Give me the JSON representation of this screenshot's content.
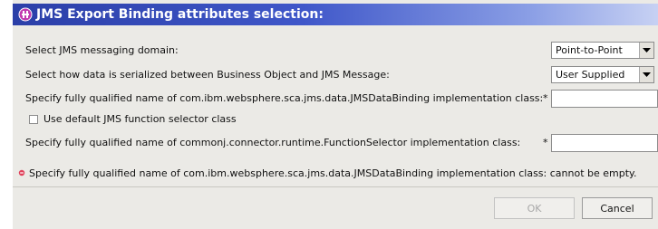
{
  "dialog": {
    "title": "JMS Export Binding attributes selection:",
    "title_icon": "plugin-icon",
    "messaging_domain": {
      "label": "Select JMS messaging domain:",
      "value": "Point-to-Point"
    },
    "serialization": {
      "label": "Select how data is serialized between Business Object and JMS Message:",
      "value": "User Supplied"
    },
    "databinding_class": {
      "label": "Specify fully qualified name of com.ibm.websphere.sca.jms.data.JMSDataBinding implementation class:",
      "required_mark": "*",
      "value": ""
    },
    "default_selector": {
      "label": "Use default JMS function selector class",
      "checked": false
    },
    "selector_class": {
      "label": "Specify fully qualified name of commonj.connector.runtime.FunctionSelector implementation class:",
      "required_mark": "*",
      "value": ""
    },
    "error_message": "Specify fully qualified name of com.ibm.websphere.sca.jms.data.JMSDataBinding implementation class: cannot be empty.",
    "buttons": {
      "ok": "OK",
      "cancel": "Cancel"
    },
    "colors": {
      "title_bar": "#2b3fa8",
      "error_icon": "#e0405a"
    }
  }
}
